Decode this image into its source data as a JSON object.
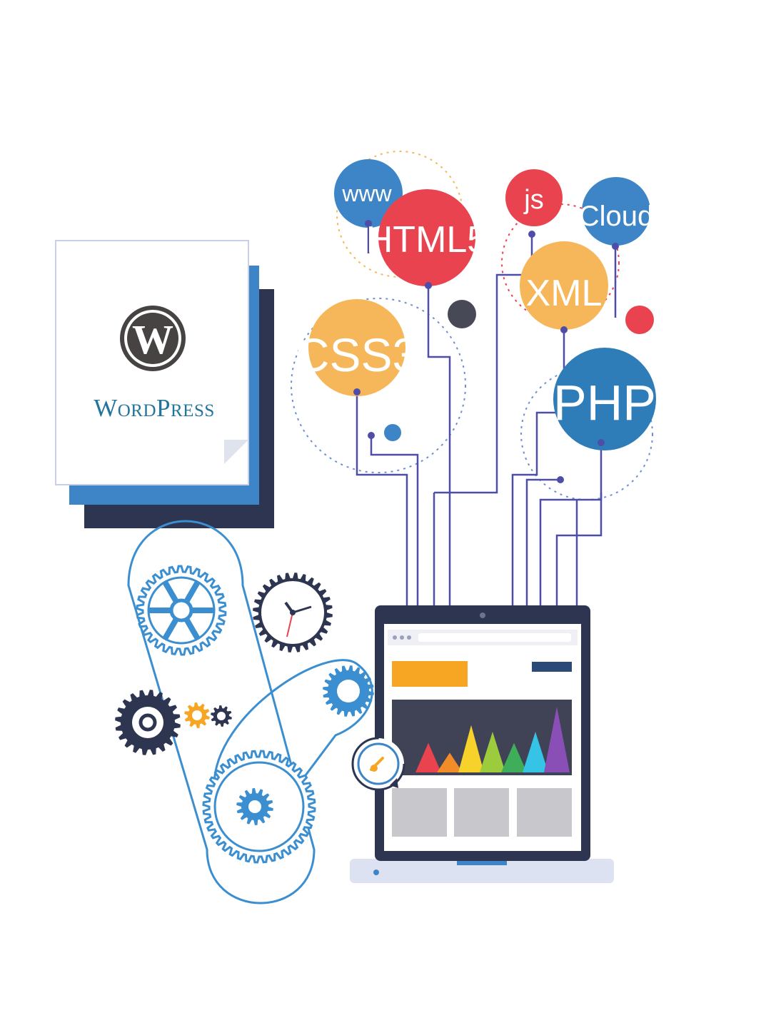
{
  "logo": {
    "wordmark": "WordPress",
    "letter": "W"
  },
  "bubbles": [
    {
      "id": "www",
      "label": "www",
      "color": "#3d85c6"
    },
    {
      "id": "html5",
      "label": "HTML5",
      "color": "#e8434f"
    },
    {
      "id": "css3",
      "label": "CSS3",
      "color": "#f6b75a"
    },
    {
      "id": "js",
      "label": "js",
      "color": "#e8434f"
    },
    {
      "id": "xml",
      "label": "XML",
      "color": "#f6b75a"
    },
    {
      "id": "cloud",
      "label": "Cloud",
      "color": "#3d85c6"
    },
    {
      "id": "php",
      "label": "PHP",
      "color": "#2f7db8"
    }
  ],
  "colors": {
    "navy": "#2d3550",
    "blue": "#3d85c6",
    "line": "#4e4ea8",
    "gear_blue": "#3b8fd0",
    "orange": "#f6a623"
  },
  "laptop": {
    "chart_bars": [
      {
        "color": "#e8434f",
        "level": 0.45
      },
      {
        "color": "#f28c28",
        "level": 0.3
      },
      {
        "color": "#f6d22a",
        "level": 0.72
      },
      {
        "color": "#9ccc3d",
        "level": 0.62
      },
      {
        "color": "#3fae5a",
        "level": 0.45
      },
      {
        "color": "#35c3e6",
        "level": 0.62
      },
      {
        "color": "#8a4fb6",
        "level": 1.0
      }
    ]
  }
}
